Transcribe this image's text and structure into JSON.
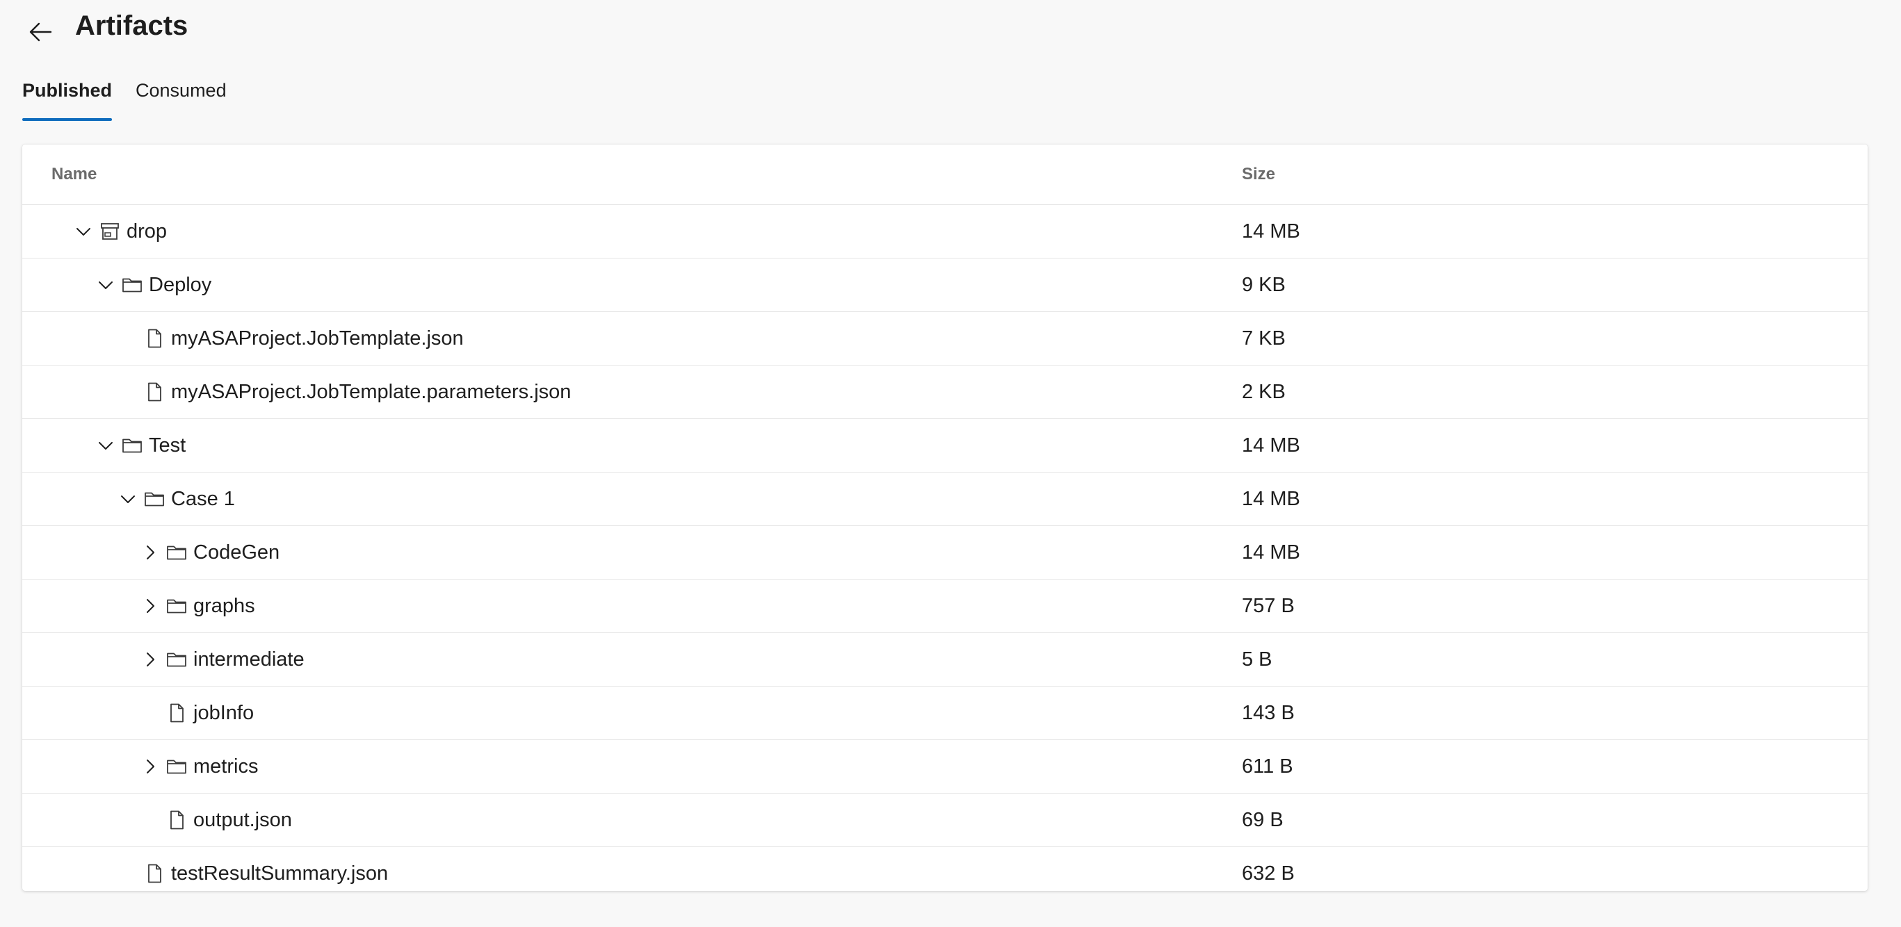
{
  "header": {
    "title": "Artifacts",
    "back_icon": "arrow-left-icon"
  },
  "tabs": [
    {
      "label": "Published",
      "active": true
    },
    {
      "label": "Consumed",
      "active": false
    }
  ],
  "table": {
    "columns": {
      "name": "Name",
      "size": "Size"
    },
    "rows": [
      {
        "name": "drop",
        "size": "14 MB",
        "level": 0,
        "type": "artifact",
        "expander": "expanded"
      },
      {
        "name": "Deploy",
        "size": "9 KB",
        "level": 1,
        "type": "folder",
        "expander": "expanded"
      },
      {
        "name": "myASAProject.JobTemplate.json",
        "size": "7 KB",
        "level": 2,
        "type": "file",
        "expander": "none"
      },
      {
        "name": "myASAProject.JobTemplate.parameters.json",
        "size": "2 KB",
        "level": 2,
        "type": "file",
        "expander": "none"
      },
      {
        "name": "Test",
        "size": "14 MB",
        "level": 1,
        "type": "folder",
        "expander": "expanded"
      },
      {
        "name": "Case 1",
        "size": "14 MB",
        "level": 2,
        "type": "folder",
        "expander": "expanded"
      },
      {
        "name": "CodeGen",
        "size": "14 MB",
        "level": 3,
        "type": "folder",
        "expander": "collapsed"
      },
      {
        "name": "graphs",
        "size": "757 B",
        "level": 3,
        "type": "folder",
        "expander": "collapsed"
      },
      {
        "name": "intermediate",
        "size": "5 B",
        "level": 3,
        "type": "folder",
        "expander": "collapsed"
      },
      {
        "name": "jobInfo",
        "size": "143 B",
        "level": 3,
        "type": "file",
        "expander": "none"
      },
      {
        "name": "metrics",
        "size": "611 B",
        "level": 3,
        "type": "folder",
        "expander": "collapsed"
      },
      {
        "name": "output.json",
        "size": "69 B",
        "level": 3,
        "type": "file",
        "expander": "none"
      },
      {
        "name": "testResultSummary.json",
        "size": "632 B",
        "level": 2,
        "type": "file",
        "expander": "none"
      }
    ]
  },
  "colors": {
    "accent": "#0f6cbd",
    "background": "#f8f8f8",
    "card": "#ffffff",
    "divider": "#e6e6e6",
    "header_text": "#6b6b6b"
  }
}
